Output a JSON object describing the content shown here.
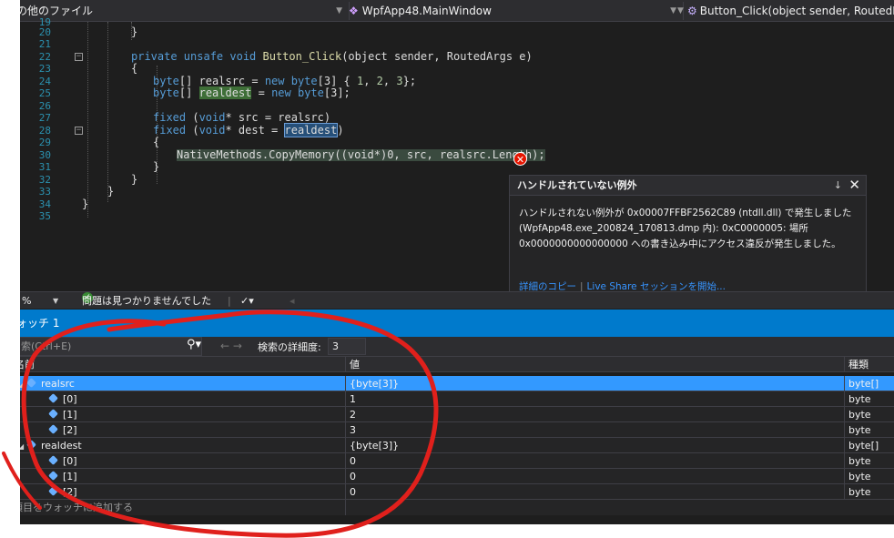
{
  "navbar": {
    "project": "その他のファイル",
    "class": "WpfApp48.MainWindow",
    "member": "Button_Click(object sender, RoutedEve"
  },
  "editor": {
    "line_numbers": [
      "19",
      "20",
      "21",
      "22",
      "23",
      "24",
      "25",
      "26",
      "27",
      "28",
      "29",
      "30",
      "31",
      "32",
      "33",
      "34",
      "35"
    ],
    "lines": {
      "l19": "",
      "l20": "}",
      "l22a": "private unsafe void ",
      "l22b": "Button_Click",
      "l22c": "(object sender, RoutedArgs e)",
      "l23": "{",
      "l24a": "byte",
      "l24b": "[] realsrc = ",
      "l24c": "new byte",
      "l24d": "[3] { ",
      "l24e": "1",
      "l24f": ", ",
      "l24g": "2",
      "l24h": ", ",
      "l24i": "3",
      "l24j": "};",
      "l25a": "byte",
      "l25b": "[] ",
      "l25c": "realdest",
      "l25d": " = ",
      "l25e": "new byte",
      "l25f": "[3];",
      "l27a": "fixed",
      "l27b": " (",
      "l27c": "void",
      "l27d": "* src = realsrc)",
      "l28a": "fixed",
      "l28b": " (",
      "l28c": "void",
      "l28d": "* dest = ",
      "l28e": "realdest",
      "l28f": ")",
      "l29": "{",
      "l30": "NativeMethods.CopyMemory((void*)0, src, realsrc.Length);",
      "l31": "}",
      "l32": "}",
      "l33": "}",
      "l34": "}"
    }
  },
  "exception": {
    "title": "ハンドルされていない例外",
    "pin": "↓",
    "close": "✕",
    "message_1": "ハンドルされない例外が 0x00007FFBF2562C89 (ntdll.dll) で発生しました",
    "message_2": "(WpfApp48.exe_200824_170813.dmp 内): 0xC0000005: 場所",
    "message_3": "0x0000000000000000 への書き込み中にアクセス違反が発生しました。",
    "link_copy": "詳細のコピー",
    "link_liveshare": "Live Share セッションを開始..."
  },
  "status": {
    "zoom": "%",
    "issues": "問題は見つかりませんでした"
  },
  "watch": {
    "title": "ォッチ 1",
    "search_placeholder": "索(Ctrl+E)",
    "depth_label": "検索の詳細度:",
    "depth_value": "3",
    "col_name": "名前",
    "col_value": "値",
    "col_type": "種類",
    "rows": [
      {
        "name": "realsrc",
        "value": "{byte[3]}",
        "type": "byte[]"
      },
      {
        "name": "[0]",
        "value": "1",
        "type": "byte"
      },
      {
        "name": "[1]",
        "value": "2",
        "type": "byte"
      },
      {
        "name": "[2]",
        "value": "3",
        "type": "byte"
      },
      {
        "name": "realdest",
        "value": "{byte[3]}",
        "type": "byte[]"
      },
      {
        "name": "[0]",
        "value": "0",
        "type": "byte"
      },
      {
        "name": "[1]",
        "value": "0",
        "type": "byte"
      },
      {
        "name": "[2]",
        "value": "0",
        "type": "byte"
      }
    ],
    "add_item": "項目をウォッチに追加する"
  },
  "colors": {
    "selection": "#3399ff",
    "annotation": "#e0201c",
    "error": "#e51400"
  }
}
